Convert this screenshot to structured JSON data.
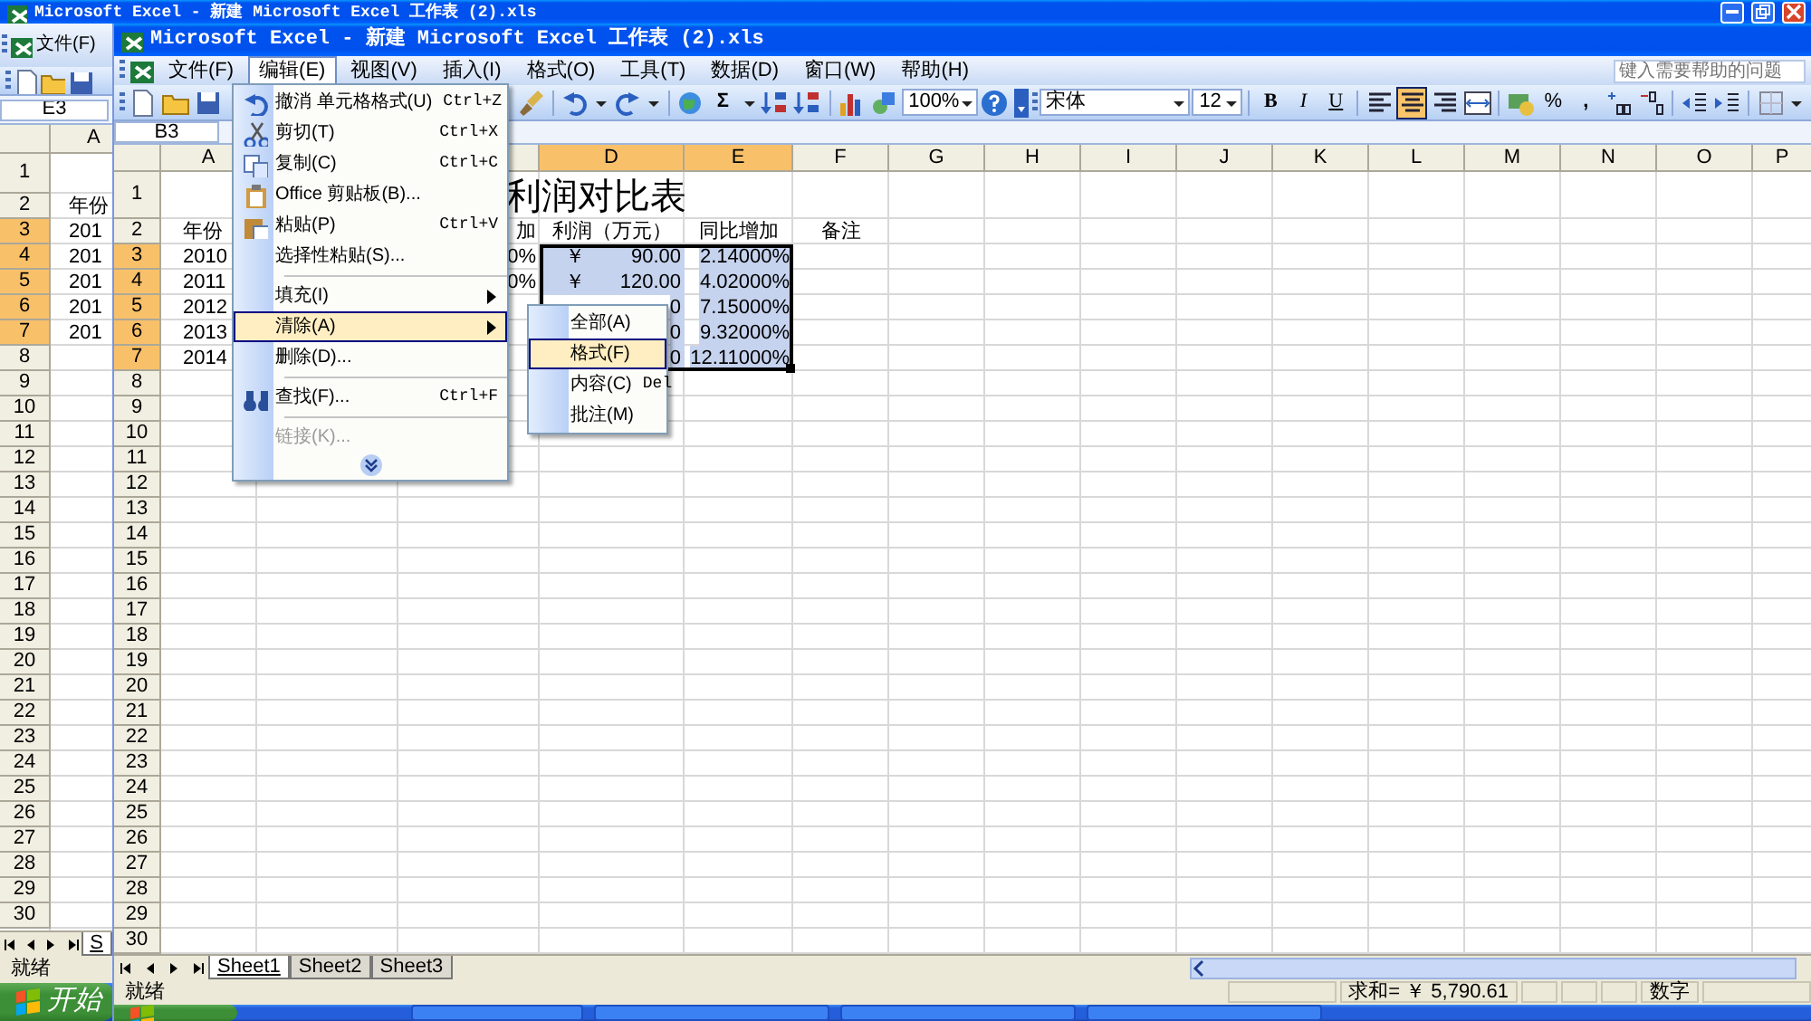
{
  "back_window": {
    "title": "Microsoft Excel - 新建 Microsoft Excel 工作表 (2).xls",
    "menu": [
      {
        "label": "文件(F)",
        "selected": false
      }
    ],
    "name_box": "E3",
    "columns": [
      {
        "label": "A",
        "selected": false
      }
    ],
    "rows": [
      {
        "header": "1",
        "selected": false
      },
      {
        "header": "2",
        "selected": false,
        "cell": "年份"
      },
      {
        "header": "3",
        "selected": true,
        "cell": "201"
      },
      {
        "header": "4",
        "selected": true,
        "cell": "201"
      },
      {
        "header": "5",
        "selected": true,
        "cell": "201"
      },
      {
        "header": "6",
        "selected": true,
        "cell": "201"
      },
      {
        "header": "7",
        "selected": true,
        "cell": "201"
      },
      {
        "header": "8",
        "selected": false
      },
      {
        "header": "9",
        "selected": false
      },
      {
        "header": "10",
        "selected": false
      },
      {
        "header": "11",
        "selected": false
      },
      {
        "header": "12",
        "selected": false
      },
      {
        "header": "13",
        "selected": false
      },
      {
        "header": "14",
        "selected": false
      },
      {
        "header": "15",
        "selected": false
      },
      {
        "header": "16",
        "selected": false
      },
      {
        "header": "17",
        "selected": false
      },
      {
        "header": "18",
        "selected": false
      },
      {
        "header": "19",
        "selected": false
      },
      {
        "header": "20",
        "selected": false
      },
      {
        "header": "21",
        "selected": false
      },
      {
        "header": "22",
        "selected": false
      },
      {
        "header": "23",
        "selected": false
      },
      {
        "header": "24",
        "selected": false
      },
      {
        "header": "25",
        "selected": false
      },
      {
        "header": "26",
        "selected": false
      },
      {
        "header": "27",
        "selected": false
      },
      {
        "header": "28",
        "selected": false
      },
      {
        "header": "29",
        "selected": false
      },
      {
        "header": "30",
        "selected": false
      }
    ],
    "sheet_tabs": [
      {
        "label": "S",
        "selected": true
      }
    ],
    "status": "就绪",
    "start_button": "开始"
  },
  "front_window": {
    "title": "Microsoft Excel - 新建 Microsoft Excel 工作表 (2).xls",
    "menu": [
      {
        "label": "文件(F)",
        "selected": false
      },
      {
        "label": "编辑(E)",
        "selected": true
      },
      {
        "label": "视图(V)",
        "selected": false
      },
      {
        "label": "插入(I)",
        "selected": false
      },
      {
        "label": "格式(O)",
        "selected": false
      },
      {
        "label": "工具(T)",
        "selected": false
      },
      {
        "label": "数据(D)",
        "selected": false
      },
      {
        "label": "窗口(W)",
        "selected": false
      },
      {
        "label": "帮助(H)",
        "selected": false
      }
    ],
    "help_box": {
      "placeholder": "键入需要帮助的问题"
    },
    "toolbar": {
      "sum": "Σ",
      "zoom": "100%",
      "font": "宋体",
      "font_size": "12",
      "styles": [
        "B",
        "I",
        "U"
      ],
      "alignments": [
        {
          "selected": false
        },
        {
          "selected": true
        },
        {
          "selected": false
        },
        {
          "selected": false
        }
      ],
      "percent": "%",
      "comma": ","
    },
    "name_box": "B3",
    "sheet": {
      "title": "利润对比表",
      "columns": [
        {
          "label": "A",
          "selected": false
        },
        null,
        {
          "selected": false
        },
        {
          "label": "D",
          "selected": true
        },
        {
          "label": "E",
          "selected": true
        },
        {
          "label": "F",
          "selected": false
        },
        {
          "label": "G",
          "selected": false
        },
        {
          "label": "H",
          "selected": false
        },
        {
          "label": "I",
          "selected": false
        },
        {
          "label": "J",
          "selected": false
        },
        {
          "label": "K",
          "selected": false
        },
        {
          "label": "L",
          "selected": false
        },
        {
          "label": "M",
          "selected": false
        },
        {
          "label": "N",
          "selected": false
        },
        {
          "label": "O",
          "selected": false
        },
        {
          "label": "P",
          "selected": false
        }
      ],
      "rows": [
        {
          "header": "1",
          "selected": false
        },
        {
          "header": "2",
          "selected": false,
          "cells": [
            {
              "kind": "text",
              "text": "年份",
              "selected": false
            },
            null,
            {
              "kind": "clipped",
              "text": "加",
              "selected": false
            },
            {
              "kind": "text",
              "text": "利润（万元）",
              "selected": false
            },
            {
              "kind": "text",
              "text": "同比增加",
              "selected": false
            },
            {
              "kind": "text",
              "text": "备注",
              "selected": false
            }
          ]
        },
        {
          "header": "3",
          "selected": true,
          "cells": [
            {
              "kind": "text",
              "text": "2010",
              "selected": false
            },
            null,
            {
              "kind": "clipped",
              "text": "0%",
              "selected": false
            },
            {
              "kind": "currency",
              "symbol": "￥",
              "text": "90.00",
              "selected": true
            },
            {
              "kind": "number",
              "text": "2.14000%",
              "selected": true
            }
          ]
        },
        {
          "header": "4",
          "selected": true,
          "cells": [
            {
              "kind": "text",
              "text": "2011",
              "selected": false
            },
            null,
            {
              "kind": "clipped",
              "text": "0%",
              "selected": false
            },
            {
              "kind": "currency",
              "symbol": "￥",
              "text": "120.00",
              "selected": true
            },
            {
              "kind": "number",
              "text": "4.02000%",
              "selected": true
            }
          ]
        },
        {
          "header": "5",
          "selected": true,
          "cells": [
            {
              "kind": "text",
              "text": "2012",
              "selected": false
            },
            null,
            null,
            {
              "kind": "clipped",
              "text": "0",
              "selected": true
            },
            {
              "kind": "number",
              "text": "7.15000%",
              "selected": true
            }
          ]
        },
        {
          "header": "6",
          "selected": true,
          "cells": [
            {
              "kind": "text",
              "text": "2013",
              "selected": false
            },
            null,
            null,
            {
              "kind": "clipped",
              "text": "0",
              "selected": true
            },
            {
              "kind": "number",
              "text": "9.32000%",
              "selected": true
            }
          ]
        },
        {
          "header": "7",
          "selected": true,
          "cells": [
            {
              "kind": "text",
              "text": "2014",
              "selected": false
            },
            null,
            null,
            {
              "kind": "clipped",
              "text": "0",
              "selected": true
            },
            {
              "kind": "number",
              "text": "12.11000%",
              "selected": true
            }
          ]
        },
        {
          "header": "8",
          "selected": false
        },
        {
          "header": "9",
          "selected": false
        },
        {
          "header": "10",
          "selected": false
        },
        {
          "header": "11",
          "selected": false
        },
        {
          "header": "12",
          "selected": false
        },
        {
          "header": "13",
          "selected": false
        },
        {
          "header": "14",
          "selected": false
        },
        {
          "header": "15",
          "selected": false
        },
        {
          "header": "16",
          "selected": false
        },
        {
          "header": "17",
          "selected": false
        },
        {
          "header": "18",
          "selected": false
        },
        {
          "header": "19",
          "selected": false
        },
        {
          "header": "20",
          "selected": false
        },
        {
          "header": "21",
          "selected": false
        },
        {
          "header": "22",
          "selected": false
        },
        {
          "header": "23",
          "selected": false
        },
        {
          "header": "24",
          "selected": false
        },
        {
          "header": "25",
          "selected": false
        },
        {
          "header": "26",
          "selected": false
        },
        {
          "header": "27",
          "selected": false
        },
        {
          "header": "28",
          "selected": false
        },
        {
          "header": "29",
          "selected": false
        },
        {
          "header": "30",
          "selected": false
        }
      ]
    },
    "edit_menu": {
      "items": [
        {
          "kind": "item",
          "label": "撤消 单元格格式(U)",
          "shortcut": "Ctrl+Z",
          "submenu": false,
          "disabled": false,
          "selected": false
        },
        {
          "kind": "item",
          "label": "剪切(T)",
          "shortcut": "Ctrl+X",
          "submenu": false,
          "disabled": false,
          "selected": false
        },
        {
          "kind": "item",
          "label": "复制(C)",
          "shortcut": "Ctrl+C",
          "submenu": false,
          "disabled": false,
          "selected": false
        },
        {
          "kind": "item",
          "label": "Office 剪贴板(B)...",
          "submenu": false,
          "disabled": false,
          "selected": false
        },
        {
          "kind": "item",
          "label": "粘贴(P)",
          "shortcut": "Ctrl+V",
          "submenu": false,
          "disabled": false,
          "selected": false
        },
        {
          "kind": "item",
          "label": "选择性粘贴(S)...",
          "submenu": false,
          "disabled": false,
          "selected": false
        },
        {
          "kind": "separator"
        },
        {
          "kind": "item",
          "label": "填充(I)",
          "submenu": true,
          "disabled": false,
          "selected": false
        },
        {
          "kind": "item",
          "label": "清除(A)",
          "submenu": true,
          "disabled": false,
          "selected": true
        },
        {
          "kind": "item",
          "label": "删除(D)...",
          "submenu": false,
          "disabled": false,
          "selected": false
        },
        {
          "kind": "separator"
        },
        {
          "kind": "item",
          "label": "查找(F)...",
          "shortcut": "Ctrl+F",
          "submenu": false,
          "disabled": false,
          "selected": false
        },
        {
          "kind": "separator"
        },
        {
          "kind": "item",
          "label": "链接(K)...",
          "submenu": false,
          "disabled": true,
          "selected": false
        },
        {
          "kind": "expand"
        }
      ]
    },
    "clear_submenu": {
      "items": [
        {
          "label": "全部(A)",
          "selected": false
        },
        {
          "label": "格式(F)",
          "selected": true
        },
        {
          "label": "内容(C)",
          "shortcut": "Del",
          "selected": false
        },
        {
          "label": "批注(M)",
          "selected": false
        }
      ]
    },
    "sheet_tabs": [
      {
        "label": "Sheet1",
        "selected": true
      },
      {
        "label": "Sheet2",
        "selected": false
      },
      {
        "label": "Sheet3",
        "selected": false
      }
    ],
    "status": {
      "text": "就绪",
      "sum": "求和= ￥ 5,790.61",
      "mode": "数字"
    }
  }
}
